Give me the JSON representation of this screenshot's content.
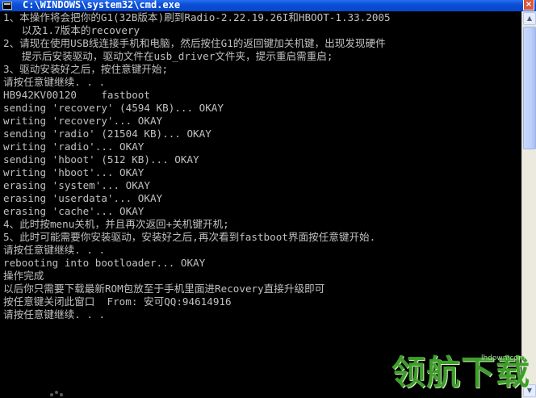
{
  "window": {
    "title": "C:\\WINDOWS\\system32\\cmd.exe",
    "close_glyph": "×"
  },
  "console": {
    "lines": [
      "1、本操作将会把你的G1(32B版本)刷到Radio-2.22.19.26I和HBOOT-1.33.2005",
      "   以及1.7版本的recovery",
      "2、请现在使用USB线连接手机和电脑，然后按住G1的返回键加关机键，出现发现硬件",
      "   提示后安装驱动，驱动文件在usb_driver文件夹，提示重启需重启;",
      "3、驱动安装好之后，按住意键开始;",
      "请按任意键继续. . .",
      "HB942KV00120    fastboot",
      "sending 'recovery' (4594 KB)... OKAY",
      "writing 'recovery'... OKAY",
      "sending 'radio' (21504 KB)... OKAY",
      "writing 'radio'... OKAY",
      "sending 'hboot' (512 KB)... OKAY",
      "writing 'hboot'... OKAY",
      "erasing 'system'... OKAY",
      "erasing 'userdata'... OKAY",
      "erasing 'cache'... OKAY",
      "4、此时按menu关机，并且再次返回+关机键开机;",
      "5、此时可能需要你安装驱动，安装好之后,再次看到fastboot界面按任意键开始.",
      "请按任意键继续. . .",
      "rebooting into bootloader... OKAY",
      "操作完成",
      "以后你只需要下载最新ROM包放至于手机里面进Recovery直接升级即可",
      "按任意键关闭此窗口  From: 安可QQ:94614916",
      "请按任意键继续. . ."
    ]
  },
  "scrollbar": {
    "up_glyph": "▲",
    "down_glyph": "▼"
  },
  "watermark": {
    "text": "领航下载",
    "url": "lhdown.com"
  }
}
